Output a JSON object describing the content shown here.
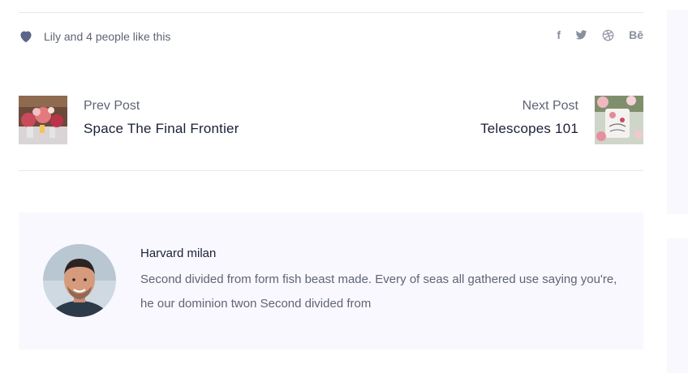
{
  "likes": {
    "text": "Lily and 4 people like this"
  },
  "social": {
    "facebook": "f",
    "behance": "Bē"
  },
  "prev_post": {
    "kicker": "Prev Post",
    "title": "Space The Final Frontier"
  },
  "next_post": {
    "kicker": "Next Post",
    "title": "Telescopes 101"
  },
  "author": {
    "name": "Harvard milan",
    "bio": "Second divided from form fish beast made. Every of seas all gathered use saying you're, he our dominion twon Second divided from"
  },
  "colors": {
    "accent": "#5a6788",
    "panel": "#f9f8fe",
    "divider": "#e8e8ee"
  }
}
